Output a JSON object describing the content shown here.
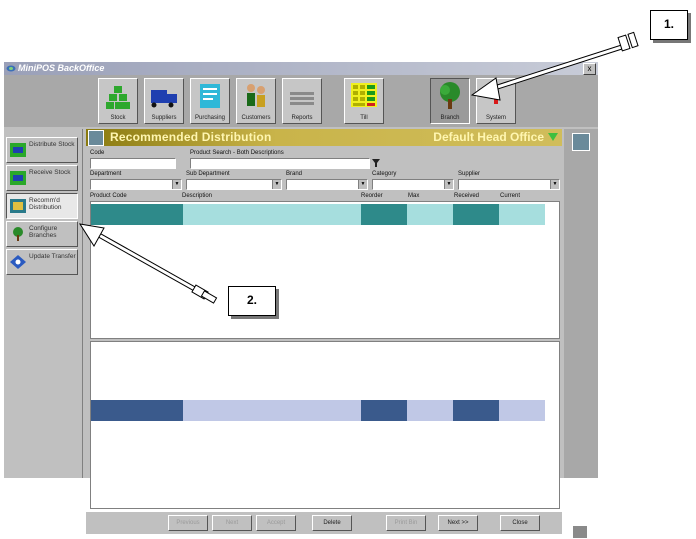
{
  "window": {
    "title": "MiniPOS BackOffice",
    "close_label": "x"
  },
  "toolbar": {
    "buttons": [
      {
        "label": "Stock",
        "icon": "stock-icon"
      },
      {
        "label": "Suppliers",
        "icon": "truck-icon"
      },
      {
        "label": "Purchasing",
        "icon": "purchasing-icon"
      },
      {
        "label": "Customers",
        "icon": "customers-icon"
      },
      {
        "label": "Reports",
        "icon": "reports-icon"
      },
      {
        "label": "Till",
        "icon": "till-icon"
      },
      {
        "label": "Branch",
        "icon": "tree-icon"
      },
      {
        "label": "System",
        "icon": "system-icon"
      }
    ]
  },
  "sidebar": {
    "items": [
      {
        "label": "Distribute Stock"
      },
      {
        "label": "Receive Stock"
      },
      {
        "label": "Recomm'd Distribution"
      },
      {
        "label": "Configure Branches"
      },
      {
        "label": "Update Transfer"
      }
    ]
  },
  "header": {
    "title": "Recommended Distribution",
    "office": "Default Head Office"
  },
  "filters": {
    "code_label": "Code",
    "search_label": "Product Search - Both Descriptions",
    "department_label": "Department",
    "subdepartment_label": "Sub Department",
    "brand_label": "Brand",
    "category_label": "Category",
    "supplier_label": "Supplier"
  },
  "columns": [
    "Product Code",
    "Description",
    "Reorder",
    "Max",
    "Received",
    "Current"
  ],
  "buttons": {
    "b1": "Previous",
    "b2": "Next",
    "b3": "Accept",
    "delete": "Delete",
    "b5": "Print Bin",
    "next": "Next >>",
    "close": "Close"
  },
  "callouts": {
    "one": "1.",
    "two": "2."
  },
  "colors": {
    "header_gold": "#c9b44a",
    "row_teal_dark": "#2e8a8a",
    "row_teal_light": "#a6dede",
    "row_navy": "#3a5a8c",
    "row_lavender": "#c0c8e6"
  }
}
